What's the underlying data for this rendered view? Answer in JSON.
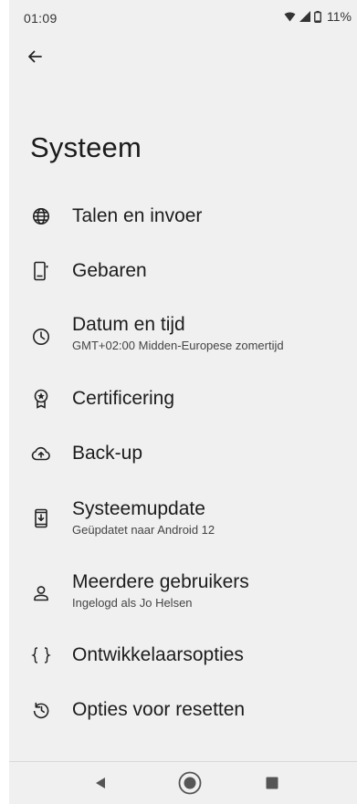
{
  "status_bar": {
    "time": "01:09",
    "battery": "11%"
  },
  "title": "Systeem",
  "items": [
    {
      "label": "Talen en invoer",
      "icon": "globe-icon"
    },
    {
      "label": "Gebaren",
      "icon": "gesture-phone-icon"
    },
    {
      "label": "Datum en tijd",
      "subtitle": "GMT+02:00 Midden-Europese zomertijd",
      "icon": "clock-icon"
    },
    {
      "label": "Certificering",
      "icon": "certificate-badge-icon"
    },
    {
      "label": "Back-up",
      "icon": "cloud-upload-icon"
    },
    {
      "label": "Systeemupdate",
      "subtitle": "Geüpdatet naar Android 12",
      "icon": "system-update-icon"
    },
    {
      "label": "Meerdere gebruikers",
      "subtitle": "Ingelogd als Jo Helsen",
      "icon": "person-icon"
    },
    {
      "label": "Ontwikkelaarsopties",
      "icon": "braces-icon"
    },
    {
      "label": "Opties voor resetten",
      "icon": "history-icon"
    }
  ]
}
